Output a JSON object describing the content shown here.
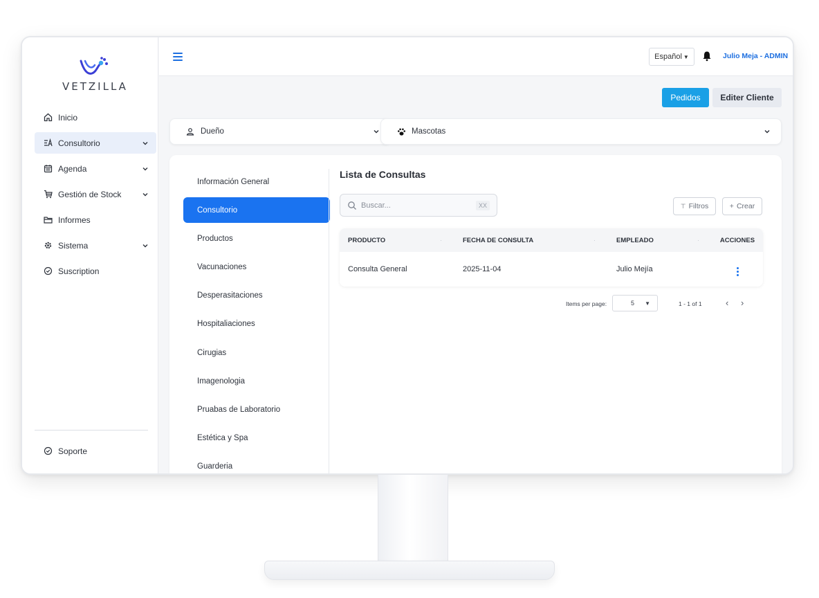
{
  "brand": {
    "name": "VETZILLA"
  },
  "sidebar": {
    "items": [
      {
        "label": "Inicio",
        "icon": "home-icon",
        "chevron": false,
        "active": false
      },
      {
        "label": "Consultorio",
        "icon": "consultorio-icon",
        "chevron": true,
        "active": true
      },
      {
        "label": "Agenda",
        "icon": "calendar-icon",
        "chevron": true,
        "active": false
      },
      {
        "label": "Gestión de Stock",
        "icon": "cart-icon",
        "chevron": true,
        "active": false
      },
      {
        "label": "Informes",
        "icon": "folder-icon",
        "chevron": false,
        "active": false
      },
      {
        "label": "Sistema",
        "icon": "gear-icon",
        "chevron": true,
        "active": false
      },
      {
        "label": "Suscription",
        "icon": "shield-icon",
        "chevron": false,
        "active": false
      }
    ],
    "support_label": "Soporte"
  },
  "topbar": {
    "language": "Español",
    "user": "Julio Meja - ADMIN"
  },
  "actions": {
    "pedidos": "Pedidos",
    "editar": "Editer Cliente"
  },
  "selectors": {
    "owner": "Dueño",
    "pets": "Mascotas"
  },
  "submenu": {
    "items": [
      "Información General",
      "Consultorio",
      "Productos",
      "Vacunaciones",
      "Desperasitaciones",
      "Hospitaliaciones",
      "Cirugias",
      "Imagenologia",
      "Pruabas de Laboratorio",
      "Estética y Spa",
      "Guarderia"
    ],
    "active_index": 1
  },
  "content": {
    "title": "Lista de Consultas",
    "search_placeholder": "Buscar...",
    "search_shortcut": "XX",
    "filter_label": "Filtros",
    "create_label": "Crear",
    "table": {
      "headers": [
        "PRODUCTO",
        "FECHA DE CONSULTA",
        "EMPLEADO",
        "ACCIONES"
      ],
      "rows": [
        [
          "Consulta General",
          "2025-11-04",
          "Julio Mejía"
        ]
      ]
    },
    "pager": {
      "items_per_page_label": "Items per page:",
      "items_per_page": "5",
      "range": "1 - 1 of 1"
    }
  },
  "colors": {
    "accent": "#1a73f0",
    "pedidos": "#1aa0e6",
    "active_nav": "#e9effa"
  }
}
